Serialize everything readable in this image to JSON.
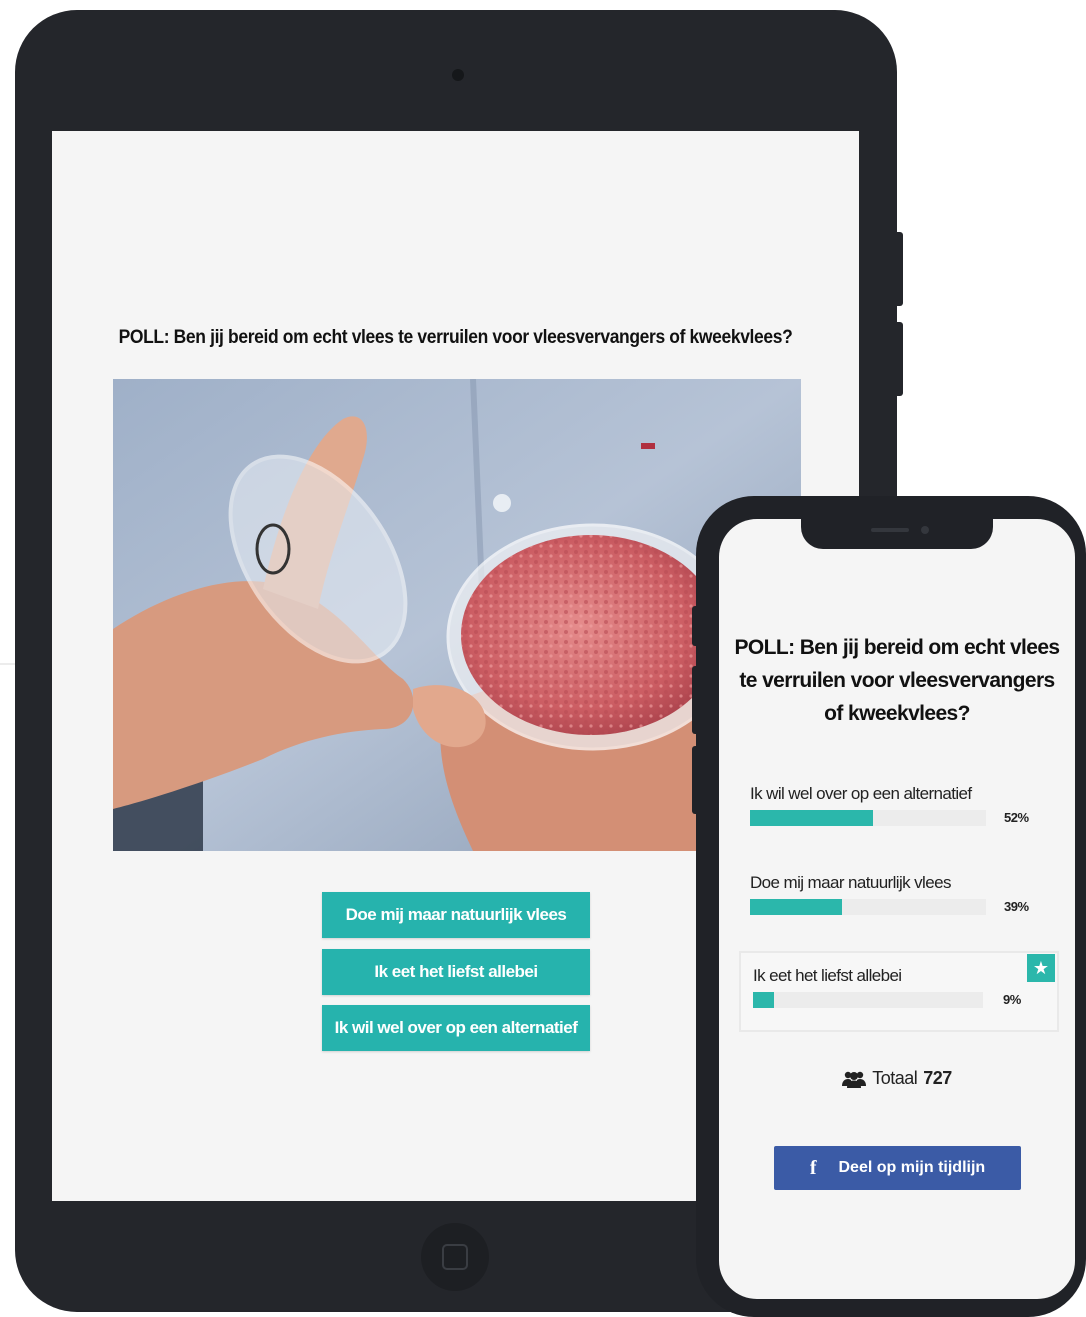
{
  "tablet": {
    "poll_question": "POLL: Ben jij bereid om echt vlees te verruilen voor vleesvervangers of kweekvlees?",
    "image_subject": "hands-holding-petri-dish-with-cultured-meat",
    "buttons": [
      {
        "label": "Doe mij maar natuurlijk vlees"
      },
      {
        "label": "Ik eet het liefst allebei"
      },
      {
        "label": "Ik wil wel over op een alternatief"
      }
    ]
  },
  "phone": {
    "poll_question": "POLL: Ben jij bereid om echt vlees te verruilen voor vleesvervangers of kweekvlees?",
    "results": [
      {
        "label": "Ik wil wel over op een alternatief",
        "percent_text": "52%",
        "percent": 52
      },
      {
        "label": "Doe mij maar natuurlijk vlees",
        "percent_text": "39%",
        "percent": 39
      },
      {
        "label": "Ik eet het liefst allebei",
        "percent_text": "9%",
        "percent": 9,
        "voted": true
      }
    ],
    "total_label": "Totaal",
    "total_value": "727",
    "share_button": "Deel op mijn tijdlijn",
    "icons": [
      "star-icon",
      "users-icon",
      "facebook-icon"
    ]
  },
  "colors": {
    "accent": "#26b3ad",
    "facebook": "#3b5ba6",
    "device_frame": "#24262b"
  }
}
